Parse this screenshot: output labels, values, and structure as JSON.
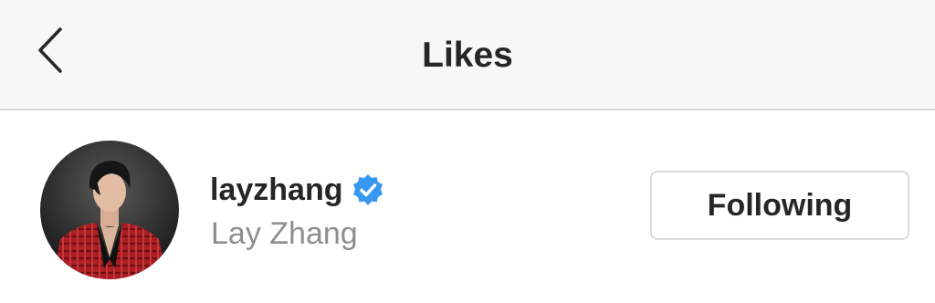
{
  "header": {
    "title": "Likes",
    "back_icon": "chevron-left-icon"
  },
  "likes": [
    {
      "username": "layzhang",
      "full_name": "Lay Zhang",
      "verified": true,
      "verified_icon": "verified-badge-icon",
      "avatar": "profile-photo",
      "follow_button_label": "Following"
    }
  ],
  "colors": {
    "header_bg": "#f7f7f7",
    "text_primary": "#262626",
    "text_secondary": "#8e8e8e",
    "verified_blue": "#3897f0",
    "button_border": "#dbdbdb",
    "divider": "#d8d8d8"
  }
}
